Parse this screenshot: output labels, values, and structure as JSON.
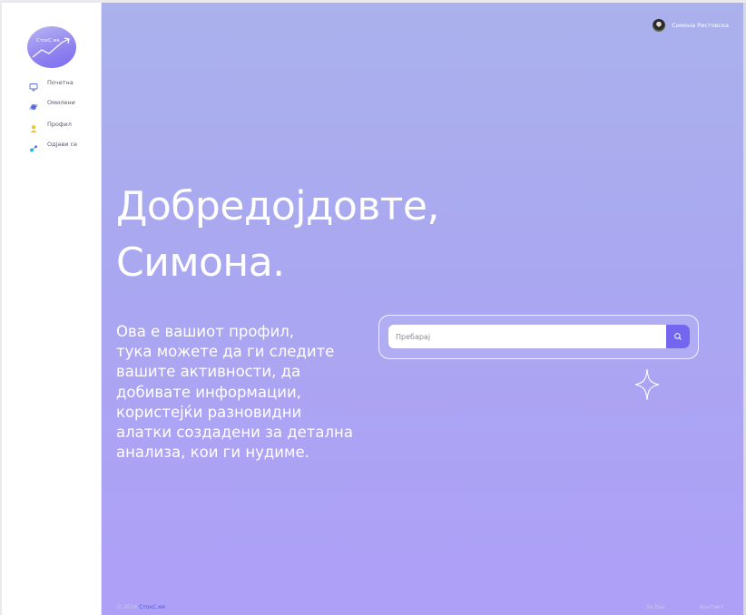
{
  "app": {
    "logo_text": "СтокС.мк"
  },
  "sidebar": {
    "items": [
      {
        "label": "Почетна",
        "icon": "monitor-icon"
      },
      {
        "label": "Омилени",
        "icon": "planet-icon"
      },
      {
        "label": "Профил",
        "icon": "user-icon"
      },
      {
        "label": "Одјави се",
        "icon": "logout-icon"
      }
    ]
  },
  "header": {
    "user_name": "Симона Ристовска"
  },
  "hero": {
    "title_line1": "Добредојдовте,",
    "title_line2": "Симона.",
    "intro_lines": [
      "Ова е вашиот профил,",
      "тука можете да ги следите",
      "вашите активности, да",
      "добивате информации,",
      "користејќи разновидни",
      "алатки создадени за детална",
      "анализа, кои ги нудиме."
    ]
  },
  "search": {
    "placeholder": "Пребарај",
    "value": ""
  },
  "footer": {
    "copyright": "© 2024",
    "brand": "СтокС.мк",
    "about": "За Нас",
    "contact": "Контакт"
  },
  "colors": {
    "accent": "#7466ee",
    "brand_link": "#4a5ee8",
    "gradient_top": "#aab1ec",
    "gradient_bottom": "#ae9ff7"
  }
}
